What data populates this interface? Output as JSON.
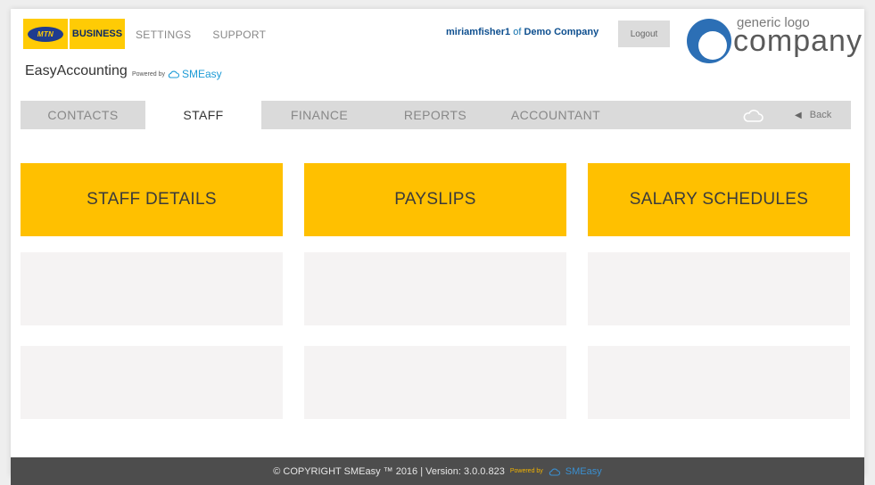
{
  "brand": {
    "mtn": "MTN",
    "business": "BUSINESS"
  },
  "top_nav": {
    "settings": "SETTINGS",
    "support": "SUPPORT"
  },
  "app": {
    "name": "EasyAccounting",
    "powered_by": "Powered by",
    "powered_brand": "SMEasy"
  },
  "user": {
    "username": "miriamfisher1",
    "of": "of",
    "company": "Demo Company",
    "logout_label": "Logout"
  },
  "company_logo": {
    "generic": "generic logo",
    "company": "company"
  },
  "tabs": [
    {
      "label": "CONTACTS"
    },
    {
      "label": "STAFF",
      "active": true
    },
    {
      "label": "FINANCE"
    },
    {
      "label": "REPORTS"
    },
    {
      "label": "ACCOUNTANT"
    }
  ],
  "back_label": "Back",
  "tiles": {
    "staff_details": "STAFF DETAILS",
    "payslips": "PAYSLIPS",
    "salary_schedules": "SALARY SCHEDULES"
  },
  "footer": {
    "copyright": "© COPYRIGHT SMEasy ™ 2016 | Version: 3.0.0.823",
    "powered_by": "Powered by",
    "brand": "SMEasy"
  },
  "colors": {
    "accent_yellow": "#ffc000",
    "mtn_yellow": "#ffcb05",
    "nav_grey": "#dadada",
    "footer_bg": "#4d4d4d",
    "link_blue": "#0e6fad"
  }
}
